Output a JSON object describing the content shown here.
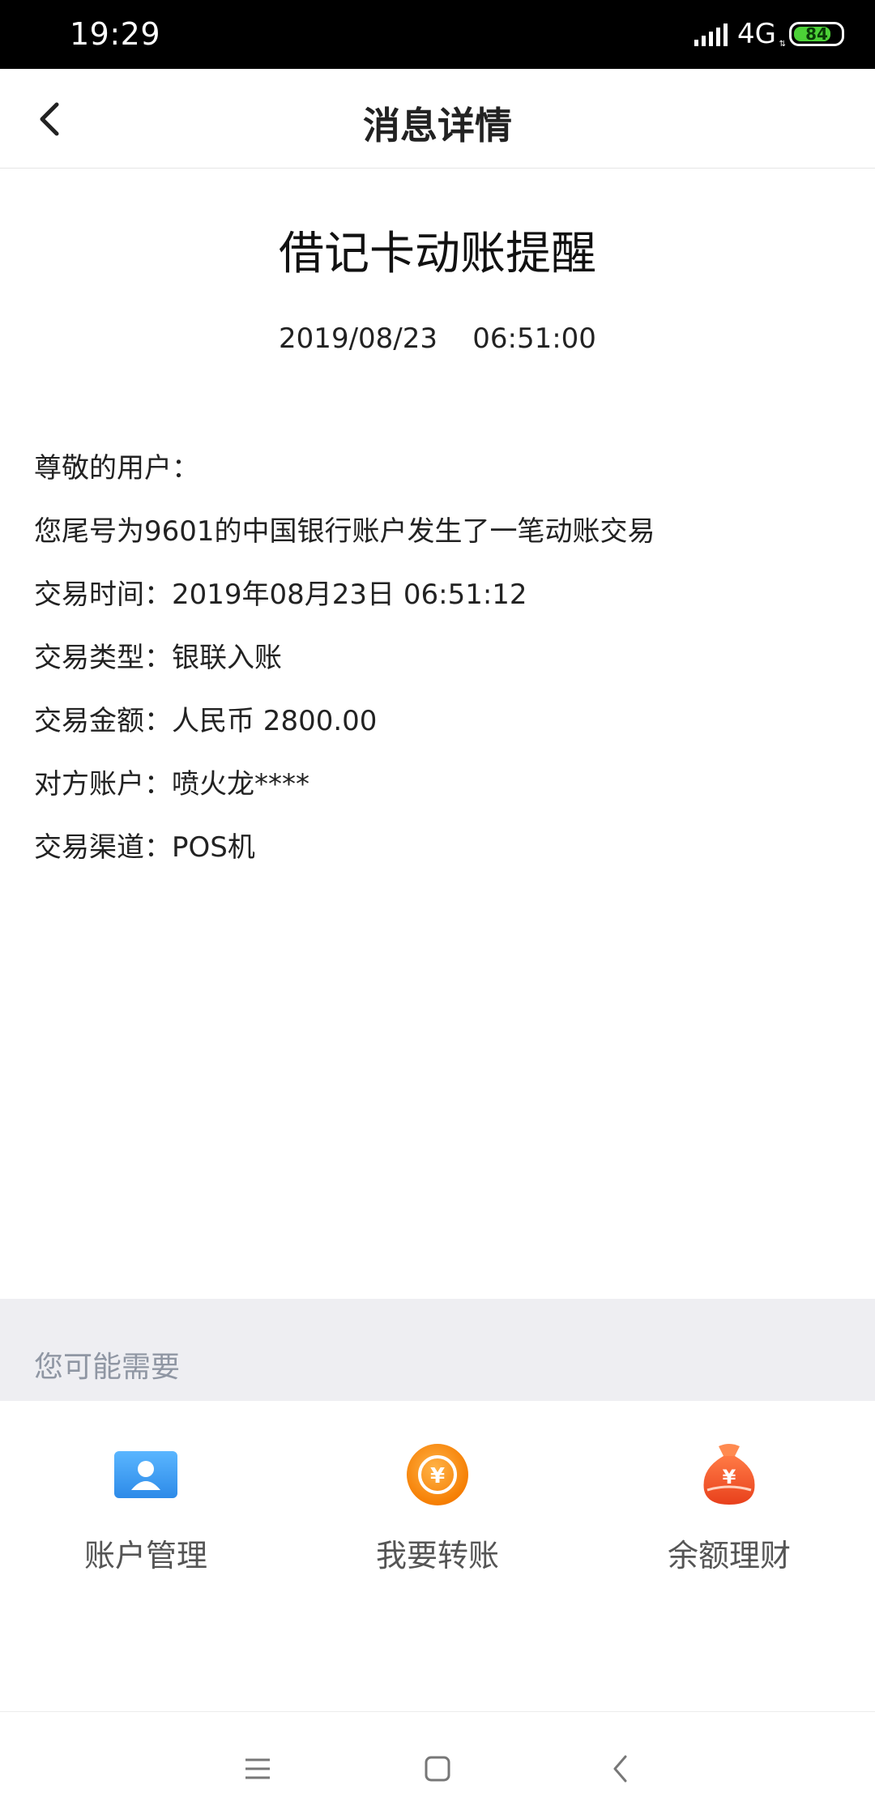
{
  "status_bar": {
    "time": "19:29",
    "network": "4G",
    "battery": "84",
    "battery_level": 0.84
  },
  "nav": {
    "title": "消息详情",
    "back_icon": "chevron-left-icon"
  },
  "message": {
    "title": "借记卡动账提醒",
    "datetime": "2019/08/23    06:51:00",
    "lines": [
      "尊敬的用户：",
      "您尾号为9601的中国银行账户发生了一笔动账交易",
      "交易时间：2019年08月23日 06:51:12",
      "交易类型：银联入账",
      "交易金额：人民币 2800.00",
      "对方账户：喷火龙****",
      "交易渠道：POS机"
    ]
  },
  "suggestions": {
    "header": "您可能需要",
    "items": [
      {
        "label": "账户管理",
        "icon": "account-card-icon",
        "color": "#3a9bf0"
      },
      {
        "label": "我要转账",
        "icon": "yuan-coin-icon",
        "color": "#f7931e"
      },
      {
        "label": "余额理财",
        "icon": "money-bag-icon",
        "color": "#f05a28"
      }
    ]
  },
  "system_nav": {
    "menu_icon": "menu-icon",
    "home_icon": "home-square-icon",
    "back_icon": "back-arrow-icon"
  }
}
